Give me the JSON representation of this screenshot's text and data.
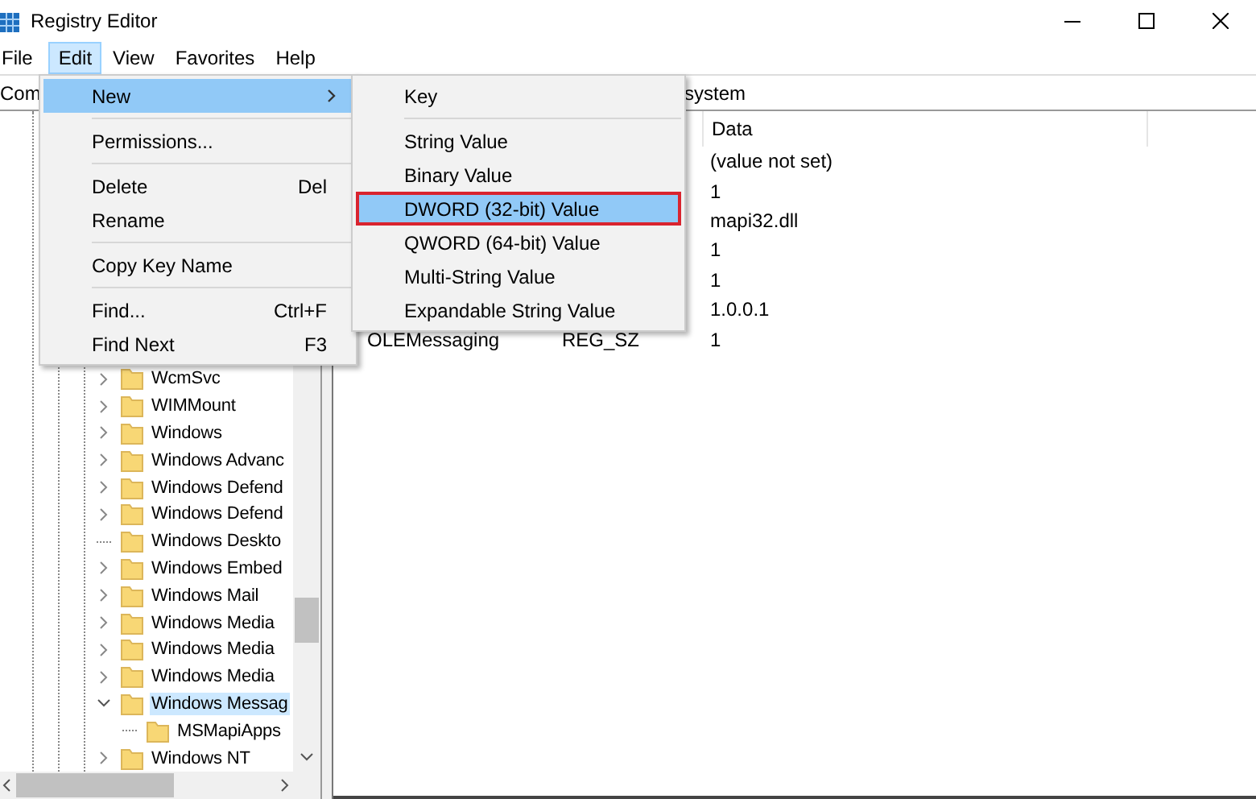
{
  "window": {
    "title": "Registry Editor"
  },
  "menu_bar": [
    {
      "label": "File",
      "selected": false
    },
    {
      "label": "Edit",
      "selected": true
    },
    {
      "label": "View",
      "selected": false
    },
    {
      "label": "Favorites",
      "selected": false
    },
    {
      "label": "Help",
      "selected": false
    }
  ],
  "address_bar": {
    "text_left": "Com",
    "text_right": "system"
  },
  "tree": {
    "items": [
      {
        "kind": "branch",
        "label": "WcmSvc",
        "expanded": false,
        "selected": false
      },
      {
        "kind": "branch",
        "label": "WIMMount",
        "expanded": false,
        "selected": false
      },
      {
        "kind": "branch",
        "label": "Windows",
        "expanded": false,
        "selected": false
      },
      {
        "kind": "branch",
        "label": "Windows Advanc",
        "expanded": false,
        "selected": false
      },
      {
        "kind": "branch",
        "label": "Windows Defend",
        "expanded": false,
        "selected": false
      },
      {
        "kind": "branch",
        "label": "Windows Defend",
        "expanded": false,
        "selected": false
      },
      {
        "kind": "leaf",
        "label": "Windows Deskto",
        "selected": false
      },
      {
        "kind": "branch",
        "label": "Windows Embed",
        "expanded": false,
        "selected": false
      },
      {
        "kind": "branch",
        "label": "Windows Mail",
        "expanded": false,
        "selected": false
      },
      {
        "kind": "branch",
        "label": "Windows Media",
        "expanded": false,
        "selected": false
      },
      {
        "kind": "branch",
        "label": "Windows Media",
        "expanded": false,
        "selected": false
      },
      {
        "kind": "branch",
        "label": "Windows Media",
        "expanded": false,
        "selected": false
      },
      {
        "kind": "branch",
        "label": "Windows Messag",
        "expanded": true,
        "selected": true,
        "children": [
          {
            "kind": "leaf",
            "label": "MSMapiApps",
            "selected": false
          }
        ]
      },
      {
        "kind": "branch",
        "label": "Windows NT",
        "expanded": false,
        "selected": false
      }
    ]
  },
  "values": {
    "header": "Data",
    "rows": [
      {
        "data": "(value not set)"
      },
      {
        "data": "1"
      },
      {
        "data": "mapi32.dll"
      },
      {
        "data": "1"
      },
      {
        "data": "1"
      },
      {
        "data": "1.0.0.1"
      },
      {
        "name": "OLEMessaging",
        "type": "REG_SZ",
        "data": "1"
      }
    ]
  },
  "edit_menu": {
    "items": [
      {
        "kind": "item",
        "label": "New",
        "submenu": true,
        "selected": true
      },
      {
        "kind": "separator"
      },
      {
        "kind": "item",
        "label": "Permissions...",
        "submenu": false,
        "selected": false
      },
      {
        "kind": "separator"
      },
      {
        "kind": "item",
        "label": "Delete",
        "shortcut": "Del",
        "submenu": false,
        "selected": false
      },
      {
        "kind": "item",
        "label": "Rename",
        "submenu": false,
        "selected": false
      },
      {
        "kind": "separator"
      },
      {
        "kind": "item",
        "label": "Copy Key Name",
        "submenu": false,
        "selected": false
      },
      {
        "kind": "separator"
      },
      {
        "kind": "item",
        "label": "Find...",
        "shortcut": "Ctrl+F",
        "submenu": false,
        "selected": false
      },
      {
        "kind": "item",
        "label": "Find Next",
        "shortcut": "F3",
        "submenu": false,
        "selected": false
      }
    ]
  },
  "new_submenu": {
    "items": [
      {
        "kind": "item",
        "label": "Key",
        "selected": false,
        "outlined": false
      },
      {
        "kind": "separator"
      },
      {
        "kind": "item",
        "label": "String Value",
        "selected": false,
        "outlined": false
      },
      {
        "kind": "item",
        "label": "Binary Value",
        "selected": false,
        "outlined": false
      },
      {
        "kind": "item",
        "label": "DWORD (32-bit) Value",
        "selected": true,
        "outlined": true
      },
      {
        "kind": "item",
        "label": "QWORD (64-bit) Value",
        "selected": false,
        "outlined": false
      },
      {
        "kind": "item",
        "label": "Multi-String Value",
        "selected": false,
        "outlined": false
      },
      {
        "kind": "item",
        "label": "Expandable String Value",
        "selected": false,
        "outlined": false
      }
    ]
  }
}
